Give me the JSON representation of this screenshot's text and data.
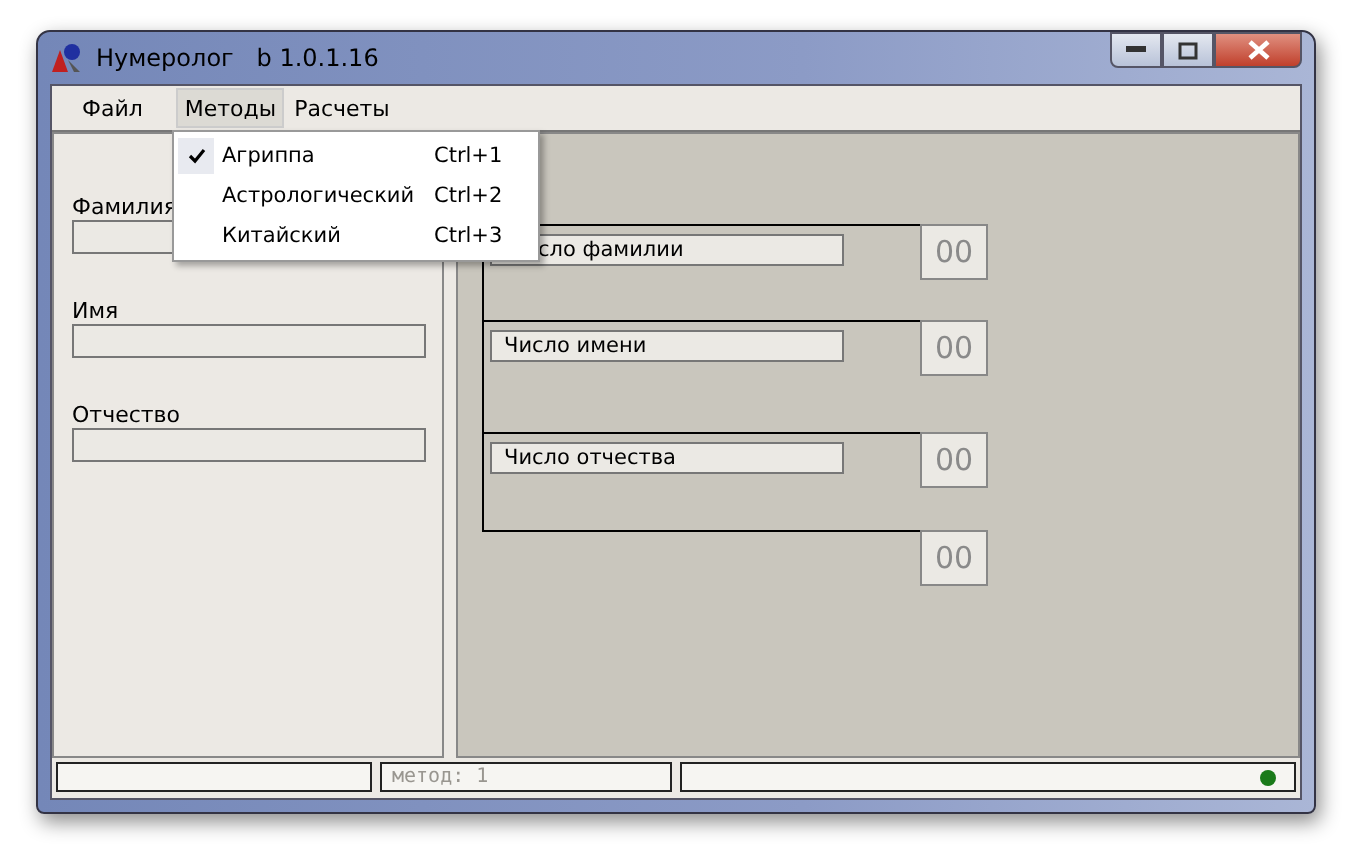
{
  "window": {
    "title": "Нумеролог   b 1.0.1.16"
  },
  "menu": [
    {
      "label": "Файл",
      "selected": false
    },
    {
      "label": "Методы",
      "selected": true
    },
    {
      "label": "Расчеты",
      "selected": false
    }
  ],
  "dropdown": [
    {
      "label": "Агриппа",
      "shortcut": "Ctrl+1",
      "checked": true
    },
    {
      "label": "Астрологический",
      "shortcut": "Ctrl+2",
      "checked": false
    },
    {
      "label": "Китайский",
      "shortcut": "Ctrl+3",
      "checked": false
    }
  ],
  "form": [
    {
      "label": "Фамилия"
    },
    {
      "label": "Имя"
    },
    {
      "label": "Отчество"
    }
  ],
  "results": [
    {
      "label": "сло фамилии",
      "value": "00"
    },
    {
      "label": "Число имени",
      "value": "00"
    },
    {
      "label": "Число отчества",
      "value": "00"
    }
  ],
  "total": {
    "value": "00"
  },
  "status_bar": {
    "panel_2": "метод: 1"
  }
}
